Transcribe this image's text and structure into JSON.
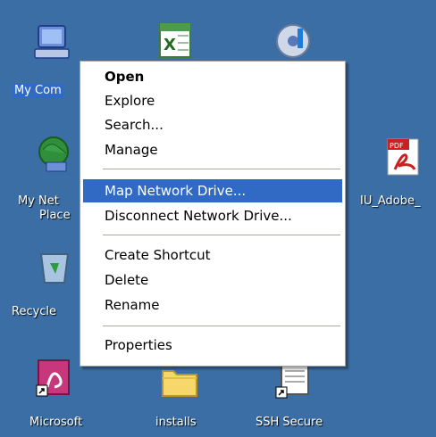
{
  "desktop": {
    "icons": {
      "my_computer": "My Com",
      "my_network_line1": "My Net",
      "my_network_line2": "Place",
      "recycle": "Recycle",
      "adobe": "IU_Adobe_",
      "access": "Microsoft",
      "installs": "installs",
      "ssh": "SSH Secure"
    },
    "pdf_badge": "PDF"
  },
  "menu": {
    "open": "Open",
    "explore": "Explore",
    "search": "Search...",
    "manage": "Manage",
    "map_drive": "Map Network Drive...",
    "disconnect_drive": "Disconnect Network Drive...",
    "create_shortcut": "Create Shortcut",
    "delete": "Delete",
    "rename": "Rename",
    "properties": "Properties"
  },
  "colors": {
    "desktop_bg": "#3a6ea5",
    "highlight": "#316ac5"
  }
}
